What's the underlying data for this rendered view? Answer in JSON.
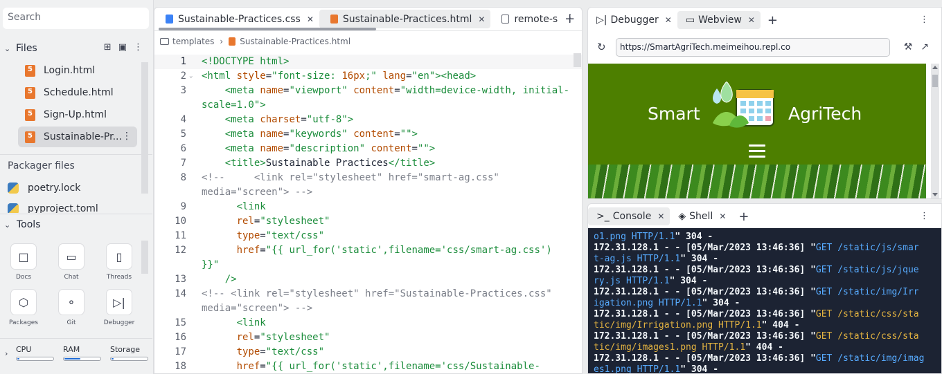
{
  "sidebar": {
    "search_placeholder": "Search",
    "files_title": "Files",
    "files": [
      {
        "name": "Login.html"
      },
      {
        "name": "Schedule.html"
      },
      {
        "name": "Sign-Up.html"
      },
      {
        "name": "Sustainable-Pr..."
      }
    ],
    "packager_title": "Packager files",
    "packager_files": [
      "poetry.lock",
      "pyproject.toml"
    ],
    "tools_title": "Tools",
    "tools": [
      {
        "label": "Docs",
        "icon": "book-icon"
      },
      {
        "label": "Chat",
        "icon": "chat-icon"
      },
      {
        "label": "Threads",
        "icon": "inbox-icon"
      },
      {
        "label": "Packages",
        "icon": "cube-icon"
      },
      {
        "label": "Git",
        "icon": "git-icon"
      },
      {
        "label": "Debugger",
        "icon": "debugger-icon"
      }
    ],
    "resources": [
      {
        "label": "CPU",
        "level": 0.05
      },
      {
        "label": "RAM",
        "level": 0.45
      },
      {
        "label": "Storage",
        "level": 0.05
      }
    ]
  },
  "editor": {
    "tabs": [
      {
        "label": "Sustainable-Practices.css",
        "icon": "css-icon"
      },
      {
        "label": "Sustainable-Practices.html",
        "icon": "html-icon",
        "active": true
      },
      {
        "label": "remote-s",
        "icon": "image-icon"
      }
    ],
    "breadcrumb": [
      "templates",
      "Sustainable-Practices.html"
    ],
    "line_numbers": [
      "1",
      "2",
      "3",
      "",
      "4",
      "5",
      "6",
      "7",
      "8",
      "",
      "9",
      "10",
      "11",
      "12",
      "",
      "13",
      "14",
      "",
      "15",
      "16",
      "17",
      "18"
    ]
  },
  "webview": {
    "tabs": [
      {
        "label": "Debugger",
        "icon": "debugger-icon"
      },
      {
        "label": "Webview",
        "icon": "monitor-icon",
        "active": true
      }
    ],
    "url": "https://SmartAgriTech.meimeihou.repl.co",
    "site_brand_left": "Smart",
    "site_brand_right": "AgriTech"
  },
  "console": {
    "tabs": [
      {
        "label": "Console",
        "icon": "prompt-icon",
        "active": true
      },
      {
        "label": "Shell",
        "icon": "shell-icon"
      }
    ]
  },
  "colors": {
    "site_green": "#4d7f00",
    "html_badge": "#e8772e",
    "css_badge": "#3b82f6",
    "terminal_bg": "#1c2333"
  }
}
